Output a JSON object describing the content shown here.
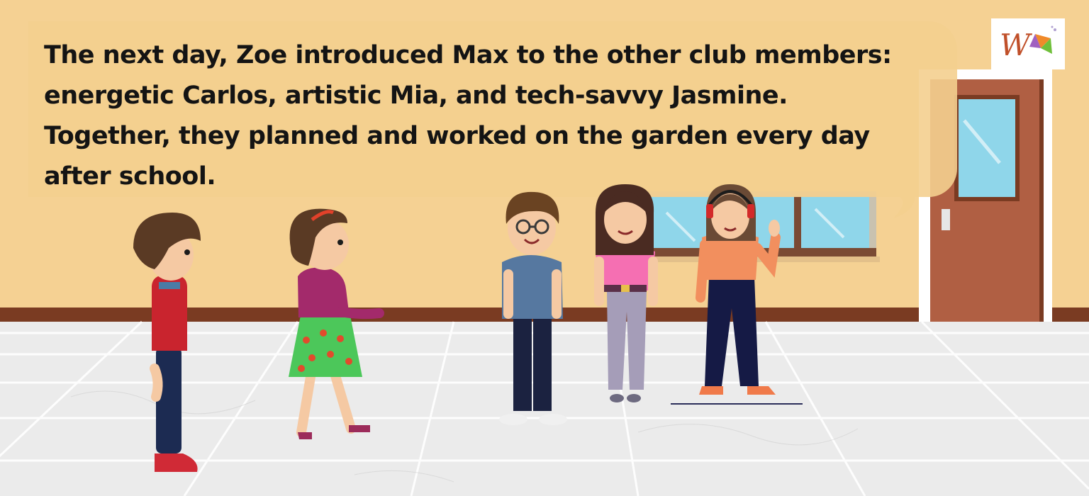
{
  "caption": {
    "lines": [
      "The next day, Zoe introduced Max to the other club members:",
      "energetic Carlos, artistic Mia, and tech-savvy Jasmine.",
      "Together, they planned and worked on the garden every day",
      "after school."
    ]
  },
  "logo": {
    "letter": "W"
  },
  "colors": {
    "wall": "#f5d193",
    "baseboard": "#7a3b22",
    "floor": "#e6e6e6",
    "door": "#b05f43",
    "window_glass": "#8fd6ea",
    "speech_bubble": "#f4cf8f"
  },
  "scene": {
    "characters": [
      "boy-red-sweater",
      "girl-green-skirt",
      "boy-glasses",
      "girl-pink-top",
      "girl-headphones-waving"
    ]
  }
}
